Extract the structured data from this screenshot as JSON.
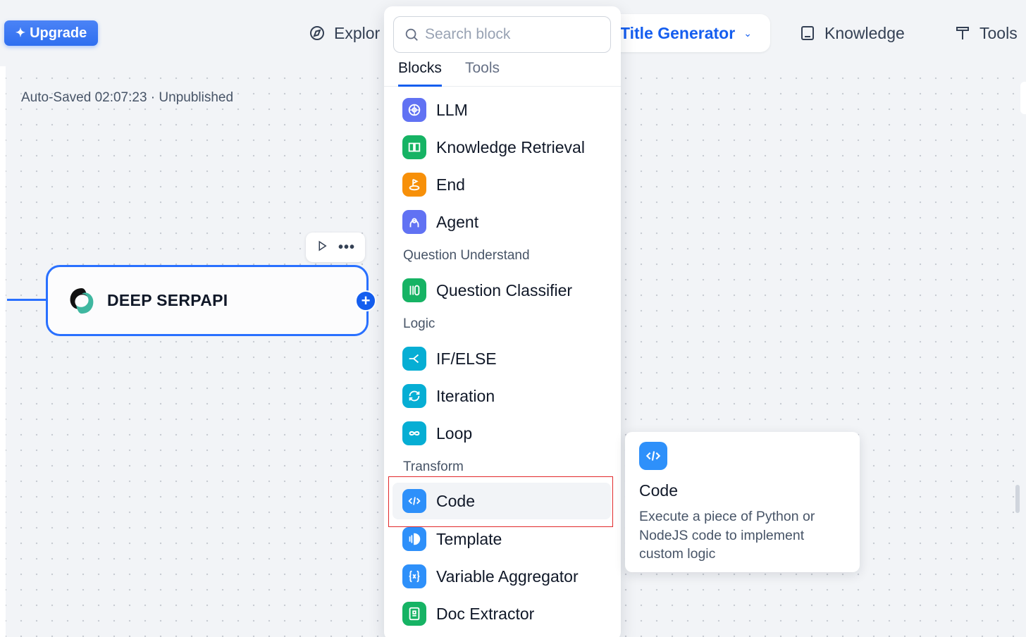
{
  "topbar": {
    "upgrade_label": "Upgrade",
    "explore_label": "Explor",
    "app_name": "Title Generator",
    "knowledge_label": "Knowledge",
    "tools_label": "Tools"
  },
  "canvas": {
    "autosave_text": "Auto-Saved 02:07:23 · Unpublished",
    "node_title": "DEEP SERPAPI"
  },
  "panel": {
    "search_placeholder": "Search block",
    "tabs": [
      "Blocks",
      "Tools"
    ],
    "active_tab": "Blocks",
    "items": [
      {
        "label": "LLM",
        "icon": "llm-icon",
        "color": "#6172f3"
      },
      {
        "label": "Knowledge Retrieval",
        "icon": "knowledge-retrieval-icon",
        "color": "#16b364"
      },
      {
        "label": "End",
        "icon": "end-icon",
        "color": "#f79009"
      },
      {
        "label": "Agent",
        "icon": "agent-icon",
        "color": "#6172f3"
      },
      {
        "label": "Question Classifier",
        "icon": "question-classifier-icon",
        "color": "#16b364"
      },
      {
        "label": "IF/ELSE",
        "icon": "if-else-icon",
        "color": "#06aed4"
      },
      {
        "label": "Iteration",
        "icon": "iteration-icon",
        "color": "#06aed4"
      },
      {
        "label": "Loop",
        "icon": "loop-icon",
        "color": "#06aed4"
      },
      {
        "label": "Code",
        "icon": "code-icon",
        "color": "#2e90fa"
      },
      {
        "label": "Template",
        "icon": "template-icon",
        "color": "#2e90fa"
      },
      {
        "label": "Variable Aggregator",
        "icon": "variable-aggregator-icon",
        "color": "#2e90fa"
      },
      {
        "label": "Doc Extractor",
        "icon": "doc-extractor-icon",
        "color": "#16b364"
      }
    ],
    "sections": [
      "Question Understand",
      "Logic",
      "Transform"
    ],
    "highlighted_item": "Code"
  },
  "tooltip": {
    "title": "Code",
    "description": "Execute a piece of Python or NodeJS code to implement custom logic"
  }
}
